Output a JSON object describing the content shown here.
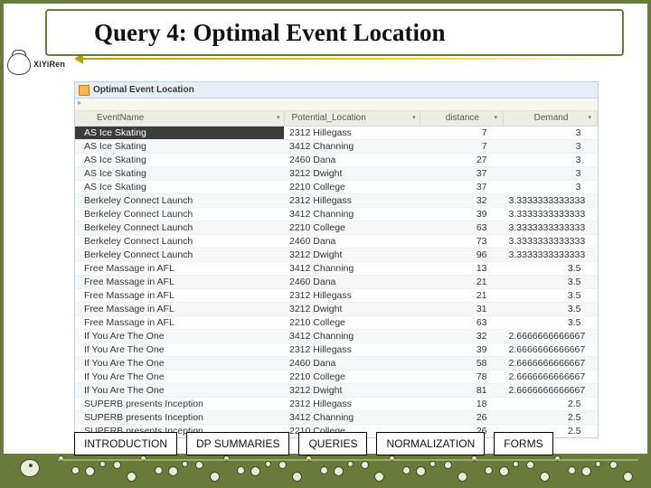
{
  "title": "Query 4: Optimal Event Location",
  "logo_text": "XiYiRen",
  "tab_label": "Optimal Event Location",
  "columns": [
    "EventName",
    "Potential_Location",
    "distance",
    "Demand"
  ],
  "rows": [
    {
      "event": "AS Ice Skating",
      "loc": "2312 Hillegass",
      "dist": "7",
      "dem": "3"
    },
    {
      "event": "AS Ice Skating",
      "loc": "3412 Channing",
      "dist": "7",
      "dem": "3"
    },
    {
      "event": "AS Ice Skating",
      "loc": "2460 Dana",
      "dist": "27",
      "dem": "3"
    },
    {
      "event": "AS Ice Skating",
      "loc": "3212 Dwight",
      "dist": "37",
      "dem": "3"
    },
    {
      "event": "AS Ice Skating",
      "loc": "2210 College",
      "dist": "37",
      "dem": "3"
    },
    {
      "event": "Berkeley Connect Launch",
      "loc": "2312 Hillegass",
      "dist": "32",
      "dem": "3.3333333333333"
    },
    {
      "event": "Berkeley Connect Launch",
      "loc": "3412 Channing",
      "dist": "39",
      "dem": "3.3333333333333"
    },
    {
      "event": "Berkeley Connect Launch",
      "loc": "2210 College",
      "dist": "63",
      "dem": "3.3333333333333"
    },
    {
      "event": "Berkeley Connect Launch",
      "loc": "2460 Dana",
      "dist": "73",
      "dem": "3.3333333333333"
    },
    {
      "event": "Berkeley Connect Launch",
      "loc": "3212 Dwight",
      "dist": "96",
      "dem": "3.3333333333333"
    },
    {
      "event": "Free Massage in AFL",
      "loc": "3412 Channing",
      "dist": "13",
      "dem": "3.5"
    },
    {
      "event": "Free Massage in AFL",
      "loc": "2460 Dana",
      "dist": "21",
      "dem": "3.5"
    },
    {
      "event": "Free Massage in AFL",
      "loc": "2312 Hillegass",
      "dist": "21",
      "dem": "3.5"
    },
    {
      "event": "Free Massage in AFL",
      "loc": "3212 Dwight",
      "dist": "31",
      "dem": "3.5"
    },
    {
      "event": "Free Massage in AFL",
      "loc": "2210 College",
      "dist": "63",
      "dem": "3.5"
    },
    {
      "event": "If You Are The One",
      "loc": "3412 Channing",
      "dist": "32",
      "dem": "2.6666666666667"
    },
    {
      "event": "If You Are The One",
      "loc": "2312 Hillegass",
      "dist": "39",
      "dem": "2.6666666666667"
    },
    {
      "event": "If You Are The One",
      "loc": "2460 Dana",
      "dist": "58",
      "dem": "2.6666666666667"
    },
    {
      "event": "If You Are The One",
      "loc": "2210 College",
      "dist": "78",
      "dem": "2.6666666666667"
    },
    {
      "event": "If You Are The One",
      "loc": "3212 Dwight",
      "dist": "81",
      "dem": "2.6666666666667"
    },
    {
      "event": "SUPERB presents Inception",
      "loc": "2312 Hillegass",
      "dist": "18",
      "dem": "2.5"
    },
    {
      "event": "SUPERB presents Inception",
      "loc": "3412 Channing",
      "dist": "26",
      "dem": "2.5"
    },
    {
      "event": "SUPERB presents Inception",
      "loc": "2210 College",
      "dist": "26",
      "dem": "2.5"
    }
  ],
  "nav": {
    "intro": "INTRODUCTION",
    "dp": "DP SUMMARIES",
    "queries": "QUERIES",
    "norm": "NORMALIZATION",
    "forms": "FORMS"
  }
}
